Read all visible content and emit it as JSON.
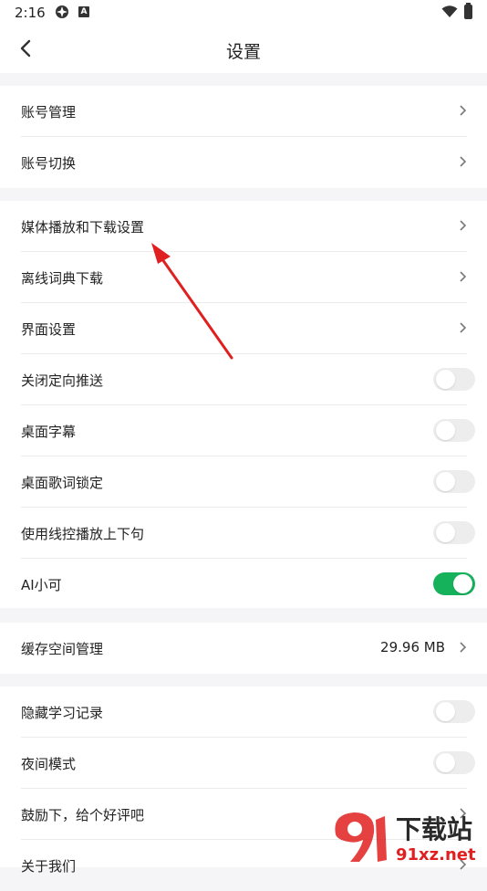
{
  "status_bar": {
    "time": "2:16"
  },
  "header": {
    "title": "设置"
  },
  "groups": [
    {
      "items": [
        {
          "label": "账号管理",
          "control": "chevron"
        },
        {
          "label": "账号切换",
          "control": "chevron"
        }
      ]
    },
    {
      "items": [
        {
          "label": "媒体播放和下载设置",
          "control": "chevron"
        },
        {
          "label": "离线词典下载",
          "control": "chevron"
        },
        {
          "label": "界面设置",
          "control": "chevron"
        },
        {
          "label": "关闭定向推送",
          "control": "toggle",
          "on": false
        },
        {
          "label": "桌面字幕",
          "control": "toggle",
          "on": false
        },
        {
          "label": "桌面歌词锁定",
          "control": "toggle",
          "on": false
        },
        {
          "label": "使用线控播放上下句",
          "control": "toggle",
          "on": false
        },
        {
          "label": "AI小可",
          "control": "toggle",
          "on": true
        }
      ]
    },
    {
      "items": [
        {
          "label": "缓存空间管理",
          "value": "29.96 MB",
          "control": "chevron"
        }
      ]
    },
    {
      "items": [
        {
          "label": "隐藏学习记录",
          "control": "toggle",
          "on": false
        },
        {
          "label": "夜间模式",
          "control": "toggle",
          "on": false
        },
        {
          "label": "鼓励下，给个好评吧",
          "control": "chevron"
        },
        {
          "label": "关于我们",
          "control": "chevron"
        }
      ]
    }
  ],
  "watermark": {
    "line1": "下载站",
    "line2": "91xz.net"
  },
  "colors": {
    "toggle_on": "#15b15b",
    "toggle_off": "#ededed",
    "annotation_arrow": "#e02020",
    "background": "#f5f5f7"
  }
}
